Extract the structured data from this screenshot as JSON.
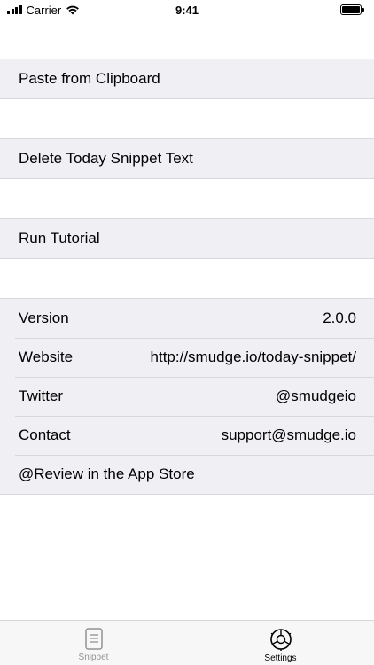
{
  "status_bar": {
    "carrier": "Carrier",
    "time": "9:41",
    "battery_level": 1.0
  },
  "actions": {
    "paste": "Paste from Clipboard",
    "delete": "Delete Today Snippet Text",
    "tutorial": "Run Tutorial"
  },
  "info": {
    "version_label": "Version",
    "version_value": "2.0.0",
    "website_label": "Website",
    "website_value": "http://smudge.io/today-snippet/",
    "twitter_label": "Twitter",
    "twitter_value": "@smudgeio",
    "contact_label": "Contact",
    "contact_value": "support@smudge.io",
    "review_label": "@Review in the App Store"
  },
  "tabs": [
    {
      "label": "Snippet",
      "icon": "document-icon",
      "selected": false
    },
    {
      "label": "Settings",
      "icon": "gear-icon",
      "selected": true
    }
  ],
  "colors": {
    "group_background": "#efeff4",
    "separator": "#d8d8dc",
    "tab_inactive": "#929292",
    "tab_active": "#000000"
  }
}
